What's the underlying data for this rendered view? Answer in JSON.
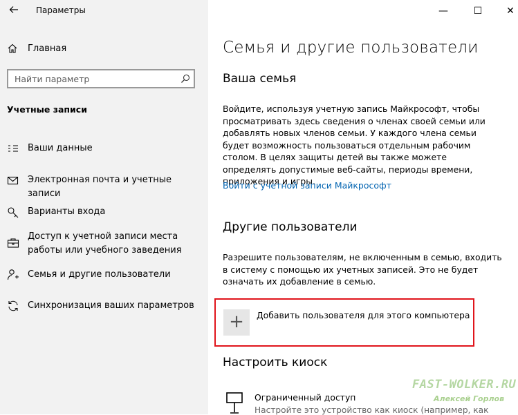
{
  "window": {
    "title": "Параметры",
    "back_icon": "arrow-left-icon",
    "minimize": "—",
    "maximize": "☐",
    "close": "✕"
  },
  "sidebar": {
    "home_label": "Главная",
    "search_placeholder": "Найти параметр",
    "section_title": "Учетные записи",
    "items": [
      {
        "label": "Ваши данные",
        "icon": "user-card-icon"
      },
      {
        "label": "Электронная почта и учетные записи",
        "icon": "mail-icon"
      },
      {
        "label": "Варианты входа",
        "icon": "key-icon"
      },
      {
        "label": "Доступ к учетной записи места работы или учебного заведения",
        "icon": "briefcase-icon"
      },
      {
        "label": "Семья и другие пользователи",
        "icon": "person-add-icon"
      },
      {
        "label": "Синхронизация ваших параметров",
        "icon": "sync-icon"
      }
    ]
  },
  "main": {
    "page_title": "Семья и другие пользователи",
    "family": {
      "heading": "Ваша семья",
      "description": "Войдите, используя учетную запись Майкрософт, чтобы просматривать здесь сведения о членах своей семьи или добавлять новых членов семьи. У каждого члена семьи будет возможность пользоваться отдельным рабочим столом. В целях защиты детей вы также можете определять допустимые веб-сайты, периоды времени, приложения и игры.",
      "link": "Войти с учетной записи Майкрософт"
    },
    "others": {
      "heading": "Другие пользователи",
      "description": "Разрешите пользователям, не включенным в семью, входить в систему с помощью их учетных записей. Это не будет означать их добавление в семью.",
      "add_button": "Добавить пользователя для этого компьютера"
    },
    "kiosk": {
      "heading": "Настроить киоск",
      "item_title": "Ограниченный доступ",
      "item_subtitle": "Настройте это устройство как киоск (например, как"
    }
  },
  "watermark": {
    "site": "FAST-WOLKER.RU",
    "author": "Алексей Горлов"
  },
  "colors": {
    "sidebar_bg": "#f2f2f2",
    "link": "#0063b1",
    "highlight_border": "#e0141b"
  }
}
